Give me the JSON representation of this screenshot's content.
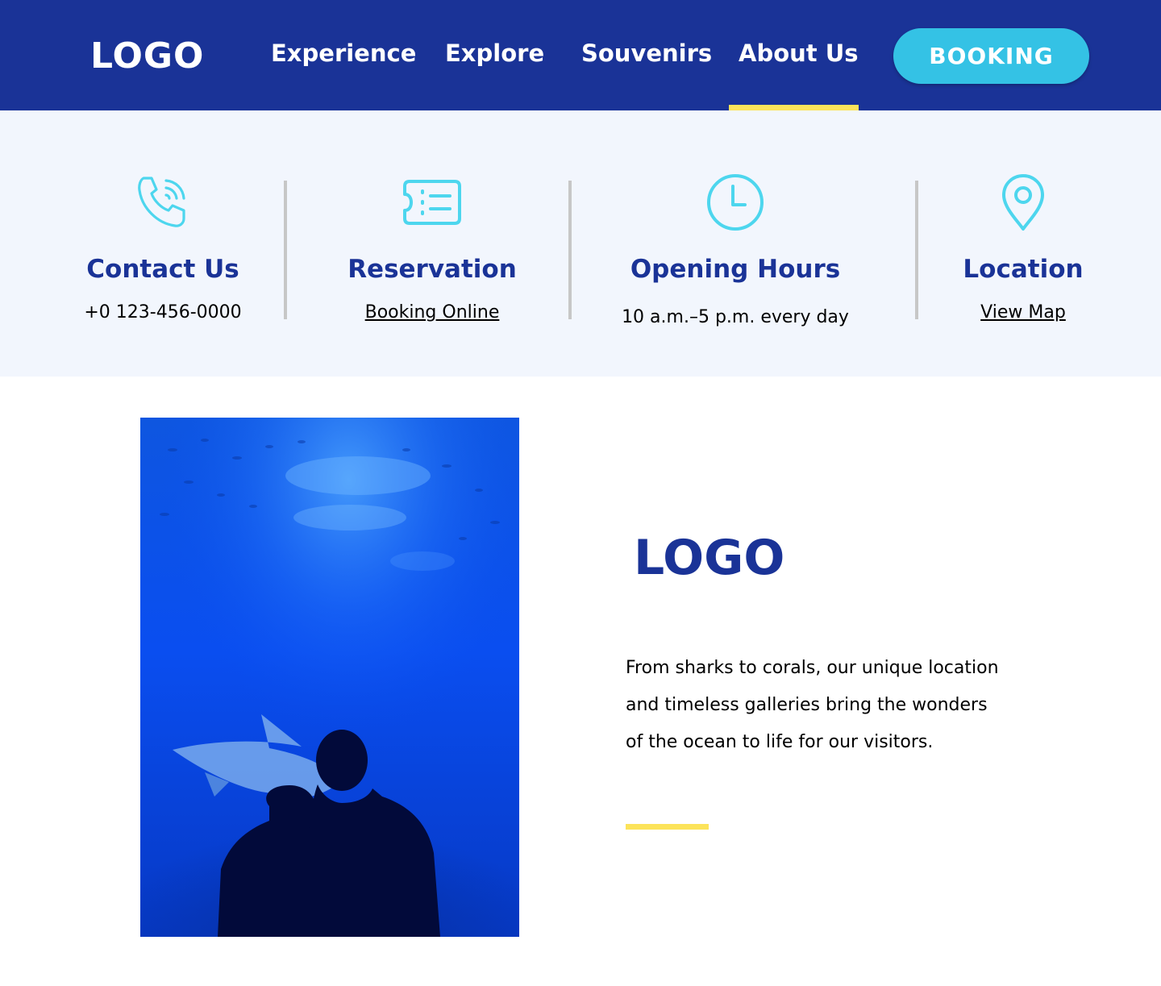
{
  "header": {
    "logo": "LOGO",
    "nav": [
      {
        "label": "Experience"
      },
      {
        "label": "Explore"
      },
      {
        "label": "Souvenirs"
      },
      {
        "label": "About Us",
        "active": true
      }
    ],
    "booking_label": "BOOKING"
  },
  "info": {
    "contact": {
      "title": "Contact Us",
      "text": "+0 123-456-0000",
      "icon": "phone-icon"
    },
    "reservation": {
      "title": "Reservation",
      "text": "Booking Online",
      "icon": "ticket-icon"
    },
    "hours": {
      "title": "Opening Hours",
      "text": "10 a.m.–5 p.m.  every day",
      "icon": "clock-icon"
    },
    "location": {
      "title": "Location",
      "text": "View Map",
      "icon": "map-pin-icon"
    }
  },
  "about": {
    "logo": "LOGO",
    "lines": [
      "From sharks to corals, our unique location",
      "and timeless galleries bring the wonders",
      "of the ocean to life for our visitors."
    ],
    "photo_subject": "couple silhouettes watching shark in aquarium tank"
  },
  "colors": {
    "brand_navy": "#1a3397",
    "accent_cyan": "#34c2e5",
    "icon_cyan": "#4dd6ee",
    "accent_yellow": "#fce35a",
    "info_bg": "#f2f6fd"
  }
}
